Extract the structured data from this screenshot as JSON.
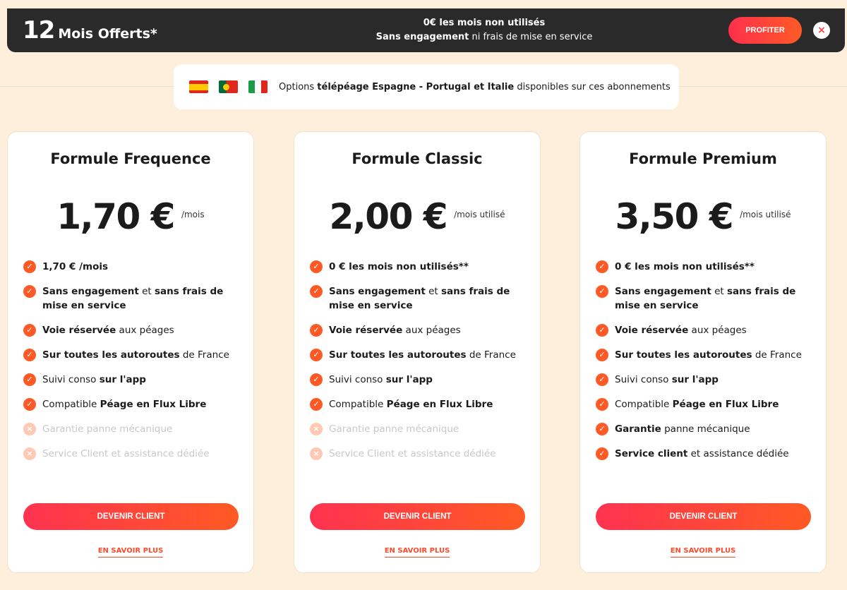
{
  "promo": {
    "big_number": "12",
    "title": "Mois Offerts*",
    "line1": "0€ les mois non utilisés",
    "line2_bold": "Sans engagement",
    "line2_rest": " ni frais de mise en service",
    "button": "PROFITER",
    "close": "×"
  },
  "options": {
    "prefix": "Options ",
    "bold1": "télépéage Espagne - Portugal et Italie",
    "suffix": " disponibles sur ces abonnements",
    "flags": [
      "spain-flag-icon",
      "portugal-flag-icon",
      "italy-flag-icon"
    ]
  },
  "colors": {
    "accent": "#ff5a26",
    "background": "#fdefdc",
    "banner": "#2a2a2a"
  },
  "cards": [
    {
      "title": "Formule Frequence",
      "price": "1,70 €",
      "period": "/mois",
      "features": [
        {
          "parts": [
            {
              "b": true,
              "t": "1,70 € /mois"
            }
          ],
          "on": true
        },
        {
          "parts": [
            {
              "b": true,
              "t": "Sans engagement"
            },
            {
              "b": false,
              "t": " et "
            },
            {
              "b": true,
              "t": "sans frais de mise en service"
            }
          ],
          "on": true
        },
        {
          "parts": [
            {
              "b": true,
              "t": "Voie réservée"
            },
            {
              "b": false,
              "t": " aux péages"
            }
          ],
          "on": true
        },
        {
          "parts": [
            {
              "b": true,
              "t": "Sur toutes les autoroutes"
            },
            {
              "b": false,
              "t": " de France"
            }
          ],
          "on": true
        },
        {
          "parts": [
            {
              "b": false,
              "t": "Suivi conso "
            },
            {
              "b": true,
              "t": "sur l'app"
            }
          ],
          "on": true
        },
        {
          "parts": [
            {
              "b": false,
              "t": "Compatible "
            },
            {
              "b": true,
              "t": "Péage en Flux Libre"
            }
          ],
          "on": true
        },
        {
          "parts": [
            {
              "b": false,
              "t": "Garantie panne mécanique"
            }
          ],
          "on": false
        },
        {
          "parts": [
            {
              "b": false,
              "t": "Service Client et assistance dédiée"
            }
          ],
          "on": false
        }
      ],
      "cta": "DEVENIR CLIENT",
      "more": "EN SAVOIR PLUS"
    },
    {
      "title": "Formule Classic",
      "price": "2,00 €",
      "period": "/mois utilisé",
      "features": [
        {
          "parts": [
            {
              "b": true,
              "t": "0 € les mois non utilisés**"
            }
          ],
          "on": true
        },
        {
          "parts": [
            {
              "b": true,
              "t": "Sans engagement"
            },
            {
              "b": false,
              "t": " et "
            },
            {
              "b": true,
              "t": "sans frais de mise en service"
            }
          ],
          "on": true
        },
        {
          "parts": [
            {
              "b": true,
              "t": "Voie réservée"
            },
            {
              "b": false,
              "t": " aux péages"
            }
          ],
          "on": true
        },
        {
          "parts": [
            {
              "b": true,
              "t": "Sur toutes les autoroutes"
            },
            {
              "b": false,
              "t": " de France"
            }
          ],
          "on": true
        },
        {
          "parts": [
            {
              "b": false,
              "t": "Suivi conso "
            },
            {
              "b": true,
              "t": "sur l'app"
            }
          ],
          "on": true
        },
        {
          "parts": [
            {
              "b": false,
              "t": "Compatible "
            },
            {
              "b": true,
              "t": "Péage en Flux Libre"
            }
          ],
          "on": true
        },
        {
          "parts": [
            {
              "b": false,
              "t": "Garantie panne mécanique"
            }
          ],
          "on": false
        },
        {
          "parts": [
            {
              "b": false,
              "t": "Service Client et assistance dédiée"
            }
          ],
          "on": false
        }
      ],
      "cta": "DEVENIR CLIENT",
      "more": "EN SAVOIR PLUS"
    },
    {
      "title": "Formule Premium",
      "price": "3,50 €",
      "period": "/mois utilisé",
      "features": [
        {
          "parts": [
            {
              "b": true,
              "t": "0 € les mois non utilisés**"
            }
          ],
          "on": true
        },
        {
          "parts": [
            {
              "b": true,
              "t": "Sans engagement"
            },
            {
              "b": false,
              "t": " et "
            },
            {
              "b": true,
              "t": "sans frais de mise en service"
            }
          ],
          "on": true
        },
        {
          "parts": [
            {
              "b": true,
              "t": "Voie réservée"
            },
            {
              "b": false,
              "t": " aux péages"
            }
          ],
          "on": true
        },
        {
          "parts": [
            {
              "b": true,
              "t": "Sur toutes les autoroutes"
            },
            {
              "b": false,
              "t": " de France"
            }
          ],
          "on": true
        },
        {
          "parts": [
            {
              "b": false,
              "t": "Suivi conso "
            },
            {
              "b": true,
              "t": "sur l'app"
            }
          ],
          "on": true
        },
        {
          "parts": [
            {
              "b": false,
              "t": "Compatible "
            },
            {
              "b": true,
              "t": "Péage en Flux Libre"
            }
          ],
          "on": true
        },
        {
          "parts": [
            {
              "b": true,
              "t": "Garantie"
            },
            {
              "b": false,
              "t": " panne mécanique"
            }
          ],
          "on": true
        },
        {
          "parts": [
            {
              "b": true,
              "t": "Service client"
            },
            {
              "b": false,
              "t": " et assistance dédiée"
            }
          ],
          "on": true
        }
      ],
      "cta": "DEVENIR CLIENT",
      "more": "EN SAVOIR PLUS"
    }
  ]
}
